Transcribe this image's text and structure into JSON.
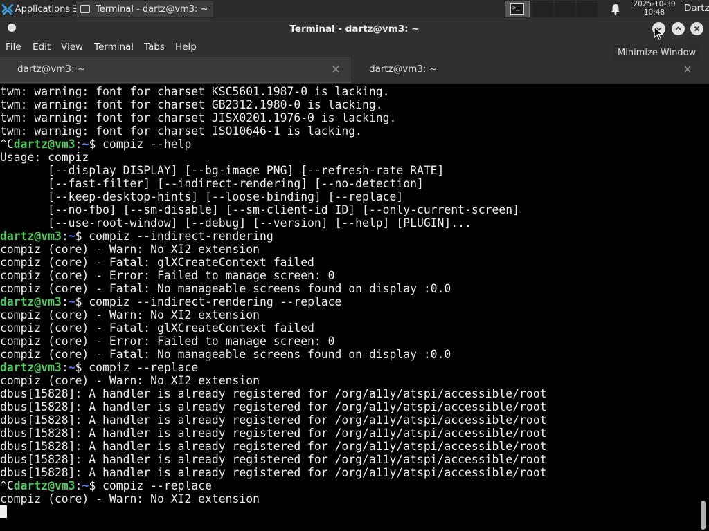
{
  "panel": {
    "apps_label": "Applications",
    "apps_label_suffix": "☰",
    "taskbar_window_title": "Terminal - dartz@vm3: ~",
    "workspace_glyph": ">_",
    "clock_date": "2025-10-30",
    "clock_time": "10:48",
    "user_name": "Dartz"
  },
  "window": {
    "title": "Terminal - dartz@vm3: ~",
    "tooltip": "Minimize Window"
  },
  "menu": {
    "file": "File",
    "edit": "Edit",
    "view": "View",
    "terminal": "Terminal",
    "tabs": "Tabs",
    "help": "Help"
  },
  "tabs": [
    {
      "label": "dartz@vm3: ~",
      "active": true
    },
    {
      "label": "dartz@vm3: ~",
      "active": false
    }
  ],
  "terminal": {
    "user_host": "dartz@vm3",
    "path": "~",
    "lines": [
      {
        "type": "out",
        "text": "twm: warning: font for charset KSC5601.1987-0 is lacking."
      },
      {
        "type": "out",
        "text": "twm: warning: font for charset GB2312.1980-0 is lacking."
      },
      {
        "type": "out",
        "text": "twm: warning: font for charset JISX0201.1976-0 is lacking."
      },
      {
        "type": "out",
        "text": "twm: warning: font for charset ISO10646-1 is lacking."
      },
      {
        "type": "prompt",
        "prefix": "^C",
        "cmd": " compiz --help"
      },
      {
        "type": "out",
        "text": "Usage: compiz"
      },
      {
        "type": "out",
        "text": "       [--display DISPLAY] [--bg-image PNG] [--refresh-rate RATE]"
      },
      {
        "type": "out",
        "text": "       [--fast-filter] [--indirect-rendering] [--no-detection]"
      },
      {
        "type": "out",
        "text": "       [--keep-desktop-hints] [--loose-binding] [--replace]"
      },
      {
        "type": "out",
        "text": "       [--no-fbo] [--sm-disable] [--sm-client-id ID] [--only-current-screen]"
      },
      {
        "type": "out",
        "text": "       [--use-root-window] [--debug] [--version] [--help] [PLUGIN]..."
      },
      {
        "type": "prompt",
        "prefix": "",
        "cmd": " compiz --indirect-rendering"
      },
      {
        "type": "out",
        "text": "compiz (core) - Warn: No XI2 extension"
      },
      {
        "type": "out",
        "text": "compiz (core) - Fatal: glXCreateContext failed"
      },
      {
        "type": "out",
        "text": "compiz (core) - Error: Failed to manage screen: 0"
      },
      {
        "type": "out",
        "text": "compiz (core) - Fatal: No manageable screens found on display :0.0"
      },
      {
        "type": "prompt",
        "prefix": "",
        "cmd": " compiz --indirect-rendering --replace"
      },
      {
        "type": "out",
        "text": "compiz (core) - Warn: No XI2 extension"
      },
      {
        "type": "out",
        "text": "compiz (core) - Fatal: glXCreateContext failed"
      },
      {
        "type": "out",
        "text": "compiz (core) - Error: Failed to manage screen: 0"
      },
      {
        "type": "out",
        "text": "compiz (core) - Fatal: No manageable screens found on display :0.0"
      },
      {
        "type": "prompt",
        "prefix": "",
        "cmd": " compiz --replace"
      },
      {
        "type": "out",
        "text": "compiz (core) - Warn: No XI2 extension"
      },
      {
        "type": "out",
        "text": "dbus[15828]: A handler is already registered for /org/a11y/atspi/accessible/root"
      },
      {
        "type": "out",
        "text": "dbus[15828]: A handler is already registered for /org/a11y/atspi/accessible/root"
      },
      {
        "type": "out",
        "text": "dbus[15828]: A handler is already registered for /org/a11y/atspi/accessible/root"
      },
      {
        "type": "out",
        "text": "dbus[15828]: A handler is already registered for /org/a11y/atspi/accessible/root"
      },
      {
        "type": "out",
        "text": "dbus[15828]: A handler is already registered for /org/a11y/atspi/accessible/root"
      },
      {
        "type": "out",
        "text": "dbus[15828]: A handler is already registered for /org/a11y/atspi/accessible/root"
      },
      {
        "type": "out",
        "text": "dbus[15828]: A handler is already registered for /org/a11y/atspi/accessible/root"
      },
      {
        "type": "prompt",
        "prefix": "^C",
        "cmd": " compiz --replace"
      },
      {
        "type": "out",
        "text": "compiz (core) - Warn: No XI2 extension"
      }
    ]
  },
  "colors": {
    "prompt_user": "#4ec95a",
    "prompt_path": "#5a7df0",
    "terminal_bg": "#000000",
    "terminal_fg": "#ececec"
  }
}
